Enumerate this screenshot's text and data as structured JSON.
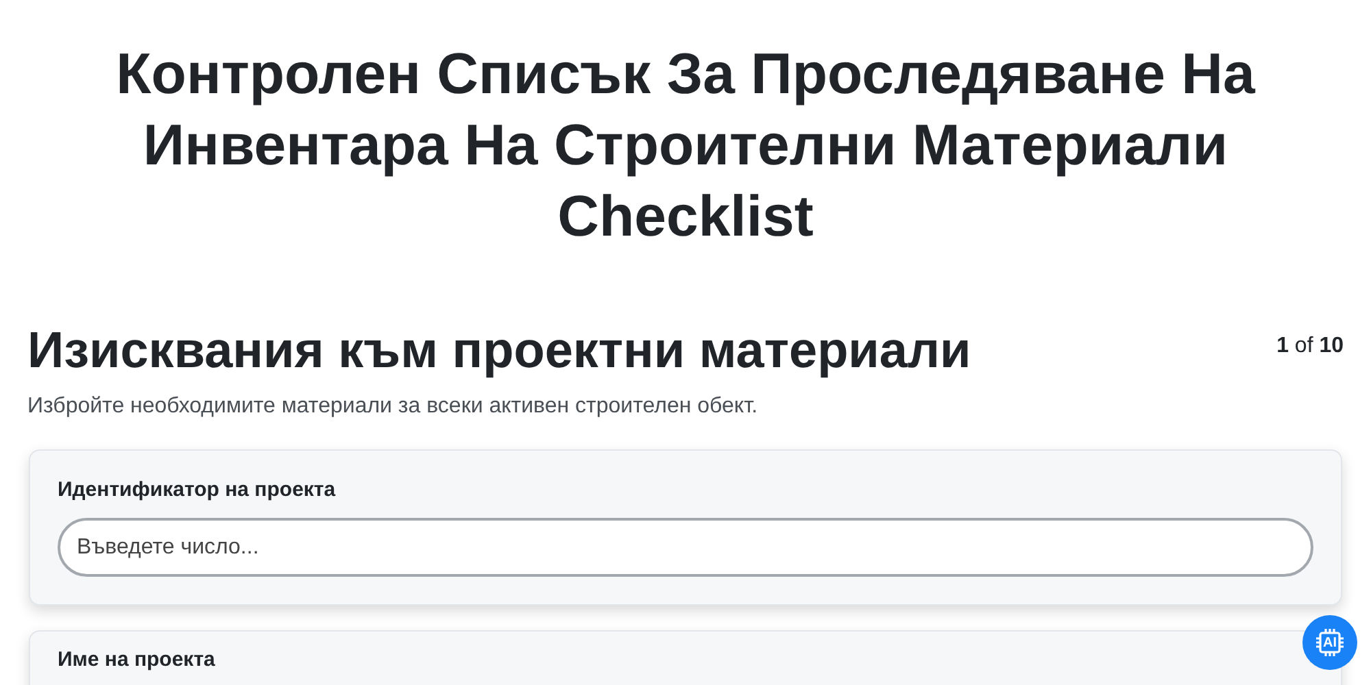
{
  "title": "Контролен Списък За Проследяване На Инвентара На Строителни Материали Checklist",
  "section": {
    "heading": "Изисквания към проектни материали",
    "pager": "**1** of **10**",
    "description": "Избройте необходимите материали за всеки активен строителен обект."
  },
  "fields": [
    {
      "label": "Идентификатор на проекта",
      "placeholder": "Въведете число..."
    },
    {
      "label": "Име на проекта"
    }
  ],
  "assistant_button": {
    "label": "AI"
  }
}
